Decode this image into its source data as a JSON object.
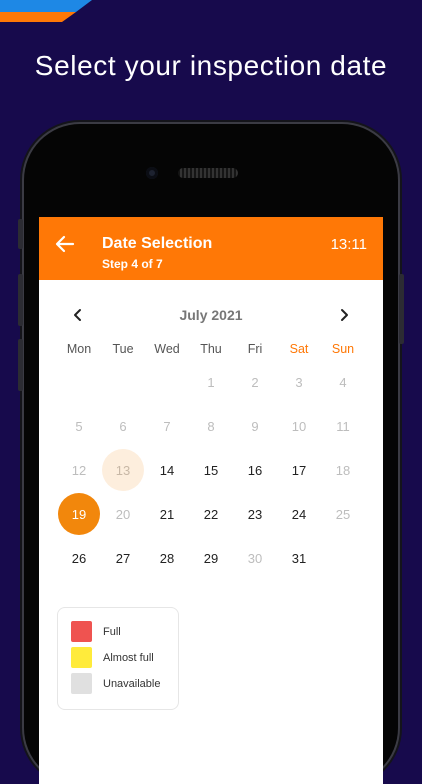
{
  "headline": "Select your inspection date",
  "app_bar": {
    "title": "Date Selection",
    "step": "Step 4 of 7",
    "time": "13:11",
    "color": "#ff7806"
  },
  "calendar": {
    "month": "July 2021",
    "prev_icon": "chevron-left-icon",
    "next_icon": "chevron-right-icon",
    "weekend_color": "#ff7806",
    "selected_color": "#f2870c",
    "weekdays": [
      {
        "label": "Mon",
        "weekend": false
      },
      {
        "label": "Tue",
        "weekend": false
      },
      {
        "label": "Wed",
        "weekend": false
      },
      {
        "label": "Thu",
        "weekend": false
      },
      {
        "label": "Fri",
        "weekend": false
      },
      {
        "label": "Sat",
        "weekend": true
      },
      {
        "label": "Sun",
        "weekend": true
      }
    ],
    "leading_blanks": 3,
    "days": [
      {
        "n": "1",
        "state": "unavailable"
      },
      {
        "n": "2",
        "state": "unavailable"
      },
      {
        "n": "3",
        "state": "unavailable"
      },
      {
        "n": "4",
        "state": "unavailable"
      },
      {
        "n": "5",
        "state": "unavailable"
      },
      {
        "n": "6",
        "state": "unavailable"
      },
      {
        "n": "7",
        "state": "unavailable"
      },
      {
        "n": "8",
        "state": "unavailable"
      },
      {
        "n": "9",
        "state": "unavailable"
      },
      {
        "n": "10",
        "state": "unavailable"
      },
      {
        "n": "11",
        "state": "unavailable"
      },
      {
        "n": "12",
        "state": "unavailable"
      },
      {
        "n": "13",
        "state": "today"
      },
      {
        "n": "14",
        "state": "available"
      },
      {
        "n": "15",
        "state": "available"
      },
      {
        "n": "16",
        "state": "available"
      },
      {
        "n": "17",
        "state": "available"
      },
      {
        "n": "18",
        "state": "unavailable"
      },
      {
        "n": "19",
        "state": "selected"
      },
      {
        "n": "20",
        "state": "unavailable"
      },
      {
        "n": "21",
        "state": "available"
      },
      {
        "n": "22",
        "state": "available"
      },
      {
        "n": "23",
        "state": "available"
      },
      {
        "n": "24",
        "state": "available"
      },
      {
        "n": "25",
        "state": "unavailable"
      },
      {
        "n": "26",
        "state": "available"
      },
      {
        "n": "27",
        "state": "available"
      },
      {
        "n": "28",
        "state": "available"
      },
      {
        "n": "29",
        "state": "available"
      },
      {
        "n": "30",
        "state": "unavailable"
      },
      {
        "n": "31",
        "state": "available"
      }
    ]
  },
  "legend": [
    {
      "label": "Full",
      "color": "#ef5350"
    },
    {
      "label": "Almost full",
      "color": "#ffeb3b"
    },
    {
      "label": "Unavailable",
      "color": "#e0e0e0"
    }
  ]
}
